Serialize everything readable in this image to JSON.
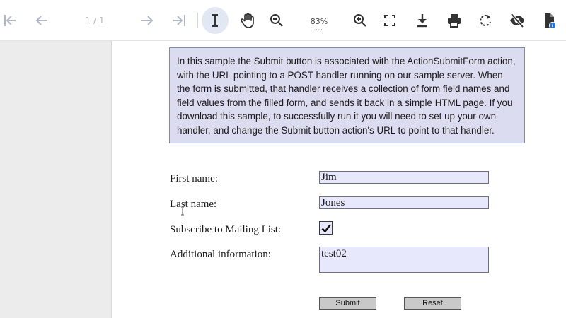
{
  "toolbar": {
    "page_indicator": "1 / 1",
    "zoom_level": "83%",
    "zoom_more": "...",
    "icons": [
      "first-page-icon",
      "previous-page-icon",
      "next-page-icon",
      "last-page-icon",
      "text-select-icon",
      "hand-tool-icon",
      "zoom-out-icon",
      "zoom-in-icon",
      "fullscreen-icon",
      "download-icon",
      "print-icon",
      "rotate-icon",
      "hide-annotations-icon",
      "document-properties-icon"
    ],
    "accent_color": "#e1e7f3",
    "icon_color": "#3a3a3a",
    "disabled_icon_color": "#b0b8c8"
  },
  "document": {
    "note_text": "In this sample the Submit button is associated with the ActionSubmitForm action, with the URL pointing to a POST handler running on our sample server. When the form is submitted, that handler receives a collection of form field names and field values from the filled form, and sends it back in a simple HTML page. If you download this sample, to successfully run it you will need to set up your own handler, and change the Submit button action's URL to point to that handler.",
    "note_color": "#dcdcf0",
    "field_color": "#e8e8fc",
    "form": {
      "first_name_label": "First name:",
      "first_name_value": "Jim",
      "last_name_label": "Last name:",
      "last_name_value": "Jones",
      "subscribe_label": "Subscribe to Mailing List:",
      "subscribe_checked": true,
      "additional_label": "Additional information:",
      "additional_value": "test02",
      "submit_label": "Submit",
      "reset_label": "Reset"
    }
  }
}
